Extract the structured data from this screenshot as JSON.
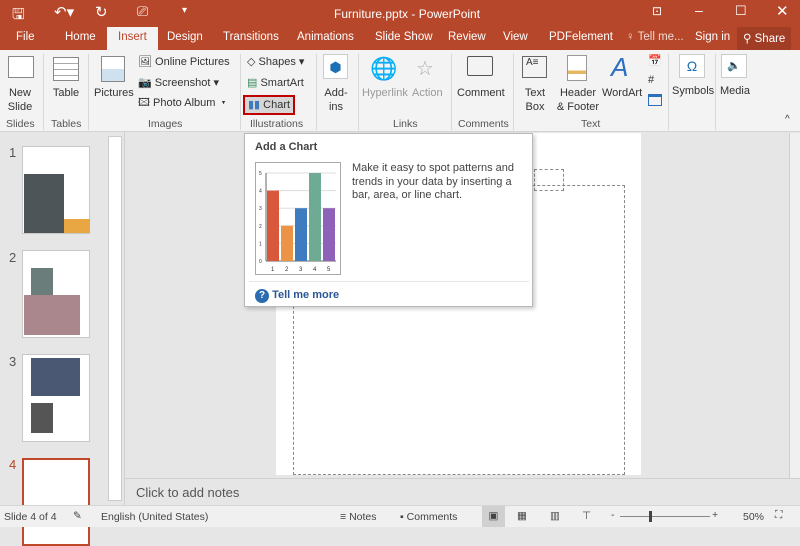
{
  "window": {
    "title": "Furniture.pptx - PowerPoint"
  },
  "tabs": [
    "File",
    "Home",
    "Insert",
    "Design",
    "Transitions",
    "Animations",
    "Slide Show",
    "Review",
    "View",
    "PDFelement"
  ],
  "active_tab": "Insert",
  "tell_me": "Tell me...",
  "sign_in": "Sign in",
  "share": "Share",
  "ribbon": {
    "new_slide": "New Slide",
    "table": "Table",
    "pictures": "Pictures",
    "online_pictures": "Online Pictures",
    "screenshot": "Screenshot",
    "photo_album": "Photo Album",
    "shapes": "Shapes",
    "smartart": "SmartArt",
    "chart": "Chart",
    "addins": "Add-ins",
    "hyperlink": "Hyperlink",
    "action": "Action",
    "comment": "Comment",
    "text_box": "Text Box",
    "header_footer": "Header & Footer",
    "wordart": "WordArt",
    "symbols": "Symbols",
    "media": "Media",
    "groups": [
      "Slides",
      "Tables",
      "Images",
      "Illustrations",
      "Links",
      "Comments",
      "Text"
    ]
  },
  "tooltip": {
    "title": "Add a Chart",
    "description": "Make it easy to spot patterns and trends in your data by inserting a bar, area, or line chart.",
    "link": "Tell me more",
    "chart_data": {
      "type": "bar",
      "categories": [
        "1",
        "2",
        "3",
        "4",
        "5"
      ],
      "values": [
        4,
        2,
        3,
        5,
        3
      ],
      "ylim": [
        0,
        5
      ],
      "yticks": [
        "0",
        "1",
        "2",
        "3",
        "4",
        "5"
      ],
      "colors": [
        "#d9573b",
        "#ec9445",
        "#3f7bbf",
        "#6fab94",
        "#8e62b8"
      ]
    }
  },
  "slides": [
    "1",
    "2",
    "3",
    "4"
  ],
  "current_slide": 4,
  "notes_placeholder": "Click to add notes",
  "status": {
    "slide": "Slide 4 of 4",
    "language": "English (United States)",
    "notes": "Notes",
    "comments": "Comments",
    "zoom": "50%"
  },
  "colors": {
    "accent": "#b7472a",
    "highlight": "#c00000"
  }
}
